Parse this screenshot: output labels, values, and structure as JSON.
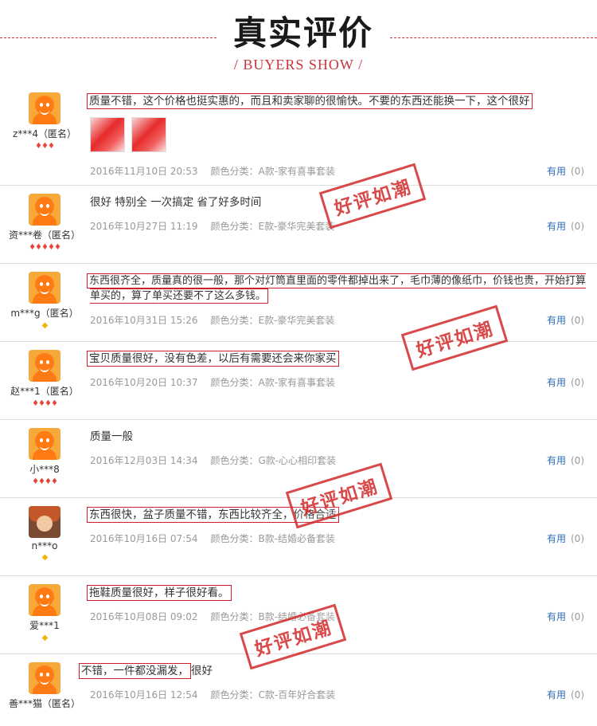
{
  "header": {
    "title": "真实评价",
    "subtitle": "/ BUYERS SHOW /"
  },
  "stamp_text": "好评如潮",
  "reviews": [
    {
      "user": "z***4（匿名）",
      "rank": "♦♦♦",
      "comment": "质量不错，这个价格也挺实惠的，而且和卖家聊的很愉快。不要的东西还能换一下，这个很好",
      "date": "2016年11月10日 20:53",
      "sku": "颜色分类：A款-家有喜事套装",
      "useful_label": "有用",
      "useful_count": "(0)"
    },
    {
      "user": "资***卷（匿名）",
      "rank": "♦♦♦♦♦",
      "comment": "很好 特别全 一次搞定 省了好多时间",
      "date": "2016年10月27日 11:19",
      "sku": "颜色分类：E款-豪华完美套装",
      "useful_label": "有用",
      "useful_count": "(0)"
    },
    {
      "user": "m***g（匿名）",
      "rank": "◆",
      "comment": "东西很齐全，质量真的很一般，那个对灯筒直里面的零件都掉出来了，毛巾薄的像纸巾，价钱也贵，开始打算单买的，算了单买还要不了这么多钱。",
      "date": "2016年10月31日 15:26",
      "sku": "颜色分类：E款-豪华完美套装",
      "useful_label": "有用",
      "useful_count": "(0)"
    },
    {
      "user": "赵***1（匿名）",
      "rank": "♦♦♦♦",
      "comment": "宝贝质量很好，没有色差，以后有需要还会来你家买",
      "date": "2016年10月20日 10:37",
      "sku": "颜色分类：A款-家有喜事套装",
      "useful_label": "有用",
      "useful_count": "(0)"
    },
    {
      "user": "小***8",
      "rank": "♦♦♦♦",
      "comment": "质量一般",
      "date": "2016年12月03日 14:34",
      "sku": "颜色分类：G款-心心相印套装",
      "useful_label": "有用",
      "useful_count": "(0)"
    },
    {
      "user": "n***o",
      "rank": "◆",
      "comment": "东西很快，盆子质量不错，东西比较齐全，价格合适",
      "date": "2016年10月16日 07:54",
      "sku": "颜色分类：B款-结婚必备套装",
      "useful_label": "有用",
      "useful_count": "(0)"
    },
    {
      "user": "爱***1",
      "rank": "◆",
      "comment": "拖鞋质量很好，样子很好看。",
      "date": "2016年10月08日 09:02",
      "sku": "颜色分类：B款-结婚必备套装",
      "useful_label": "有用",
      "useful_count": "(0)"
    },
    {
      "user": "善***猫（匿名）",
      "rank": "",
      "comment_a": "不错，一件都没漏发，",
      "comment_b": "很好",
      "date": "2016年10月16日 12:54",
      "sku": "颜色分类：C款-百年好合套装",
      "useful_label": "有用",
      "useful_count": "(0)"
    }
  ]
}
